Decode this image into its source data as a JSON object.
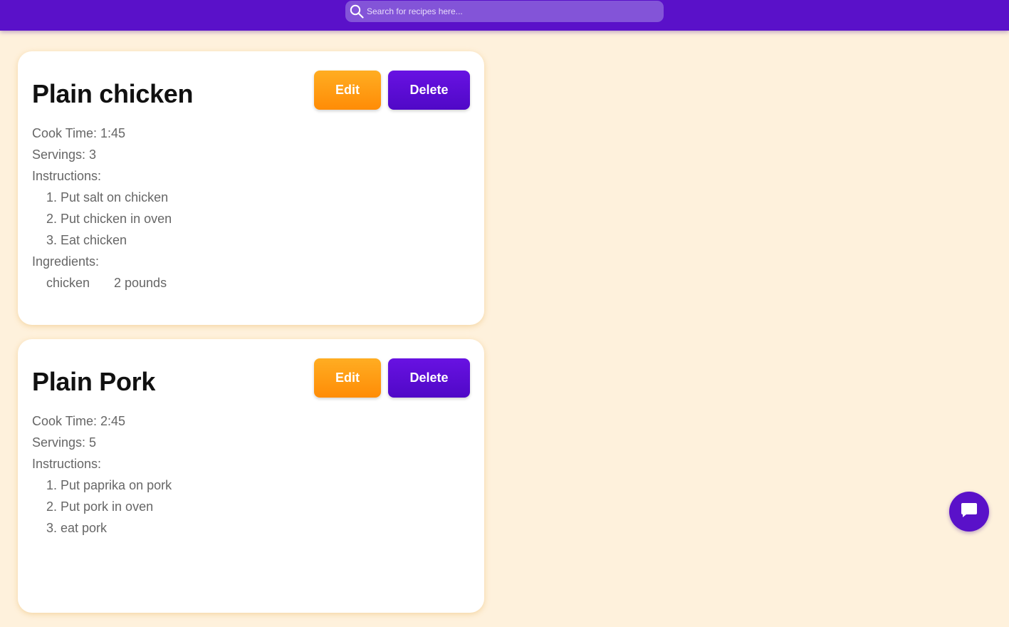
{
  "search": {
    "placeholder": "Search for recipes here...",
    "value": ""
  },
  "recipes": [
    {
      "title": "Plain chicken",
      "edit_label": "Edit",
      "delete_label": "Delete",
      "cook_time": "Cook Time: 1:45",
      "servings": "Servings: 3",
      "instructions_label": "Instructions:",
      "instructions": [
        "1. Put salt on chicken",
        "2. Put chicken in oven",
        "3. Eat chicken"
      ],
      "ingredients_label": "Ingredients:",
      "ingredients": [
        {
          "name": "chicken",
          "amount": "2 pounds"
        }
      ]
    },
    {
      "title": "Plain Pork",
      "edit_label": "Edit",
      "delete_label": "Delete",
      "cook_time": "Cook Time: 2:45",
      "servings": "Servings: 5",
      "instructions_label": "Instructions:",
      "instructions": [
        "1. Put paprika on pork",
        "2. Put pork in oven",
        "3. eat pork"
      ]
    }
  ],
  "icons": {
    "search": "search-icon",
    "chat": "chat-icon"
  },
  "colors": {
    "header": "#5a11c9",
    "background": "#fef1dc",
    "edit_button": "#ff9a10",
    "delete_button": "#5b0cd6"
  }
}
